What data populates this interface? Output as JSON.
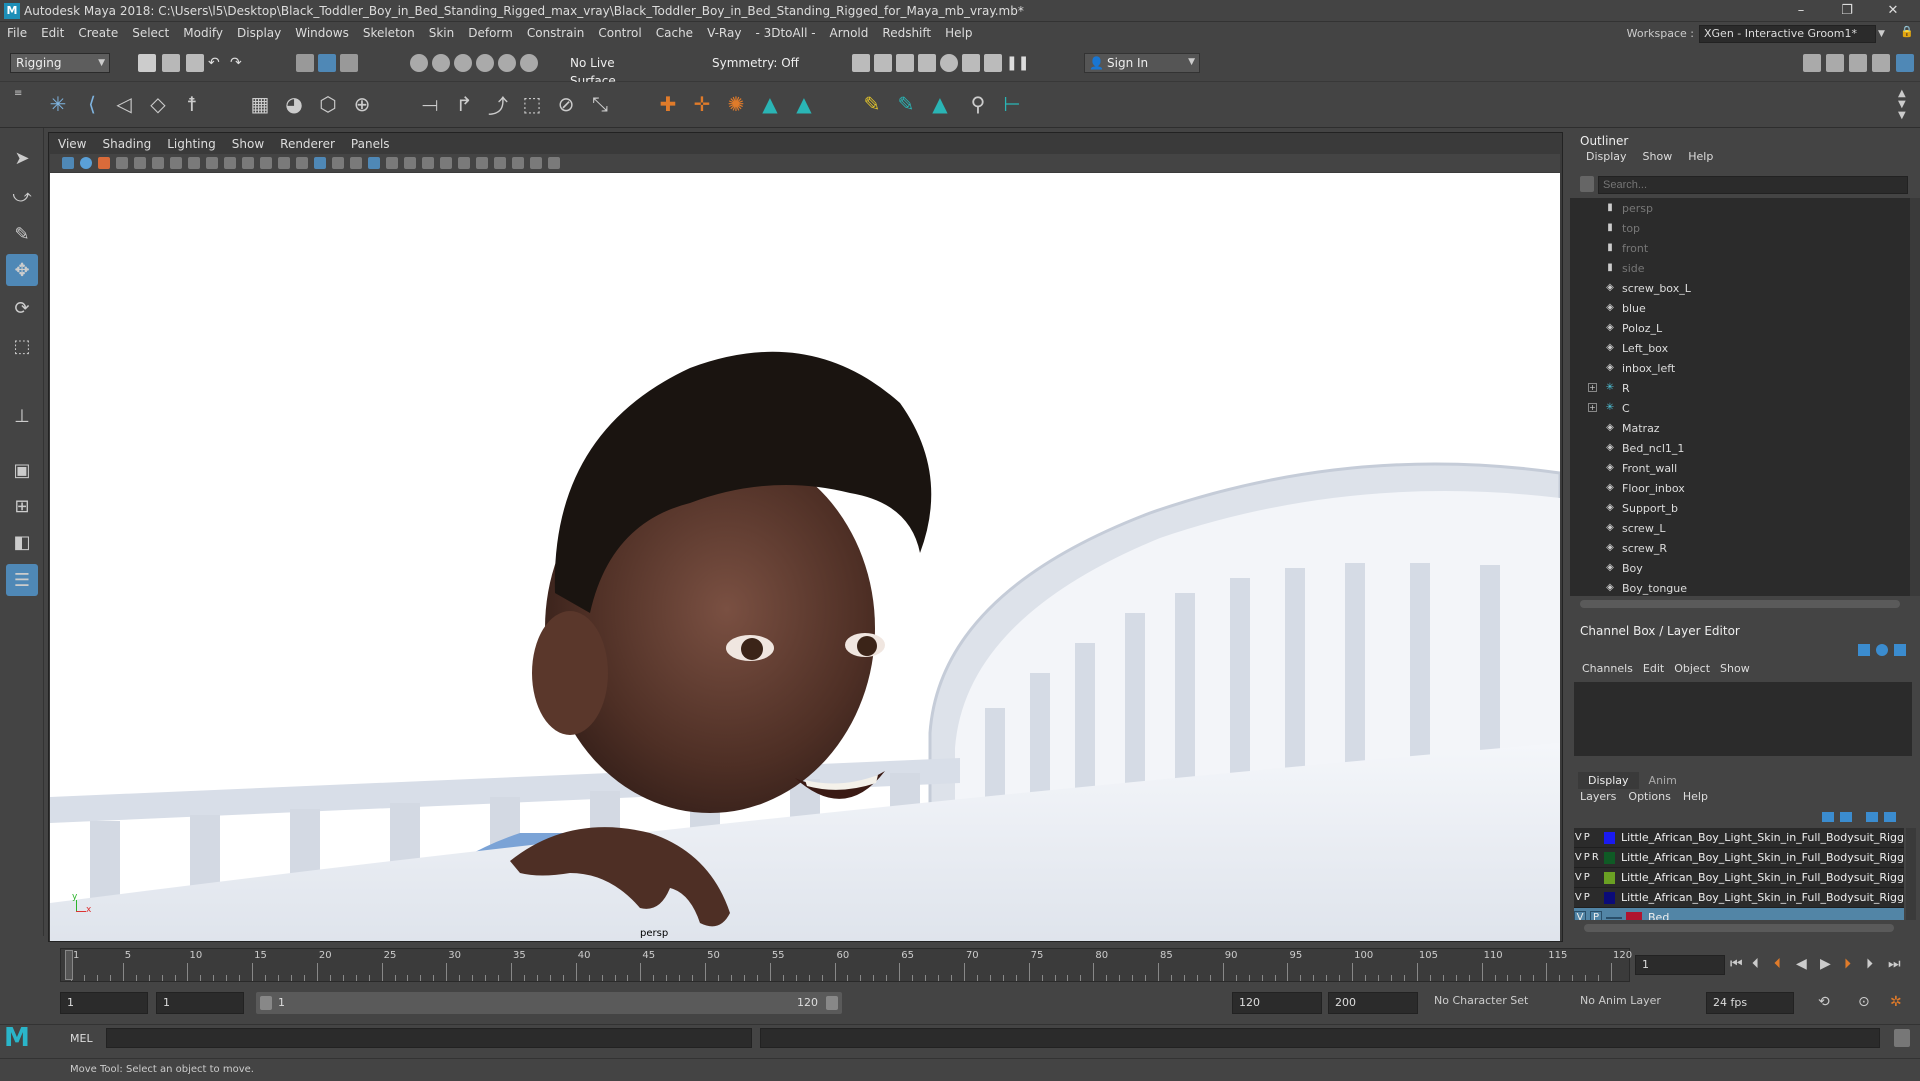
{
  "window": {
    "title": "Autodesk Maya 2018: C:\\Users\\l5\\Desktop\\Black_Toddler_Boy_in_Bed_Standing_Rigged_max_vray\\Black_Toddler_Boy_in_Bed_Standing_Rigged_for_Maya_mb_vray.mb*",
    "minimize": "–",
    "maximize": "❐",
    "close": "✕"
  },
  "menubar": [
    "File",
    "Edit",
    "Create",
    "Select",
    "Modify",
    "Display",
    "Windows",
    "Skeleton",
    "Skin",
    "Deform",
    "Constrain",
    "Control",
    "Cache",
    "V-Ray",
    "- 3DtoAll -",
    "Arnold",
    "Redshift",
    "Help"
  ],
  "workspace": {
    "label": "Workspace :",
    "value": "XGen - Interactive Groom1*"
  },
  "statusline": {
    "menuset": "Rigging",
    "live_surface": "No Live Surface",
    "symmetry": "Symmetry: Off",
    "sign_in": "Sign In"
  },
  "viewport": {
    "menus": [
      "View",
      "Shading",
      "Lighting",
      "Show",
      "Renderer",
      "Panels"
    ],
    "camera_label": "persp",
    "axis_x": "x",
    "axis_y": "y"
  },
  "outliner": {
    "title": "Outliner",
    "menus": [
      "Display",
      "Show",
      "Help"
    ],
    "search_placeholder": "Search...",
    "items": [
      {
        "label": "persp",
        "icon": "camera-icon",
        "dim": true
      },
      {
        "label": "top",
        "icon": "camera-icon",
        "dim": true
      },
      {
        "label": "front",
        "icon": "camera-icon",
        "dim": true
      },
      {
        "label": "side",
        "icon": "camera-icon",
        "dim": true
      },
      {
        "label": "screw_box_L",
        "icon": "mesh-icon"
      },
      {
        "label": "blue",
        "icon": "mesh-icon"
      },
      {
        "label": "Poloz_L",
        "icon": "mesh-icon"
      },
      {
        "label": "Left_box",
        "icon": "mesh-icon"
      },
      {
        "label": "inbox_left",
        "icon": "mesh-icon"
      },
      {
        "label": "R",
        "icon": "joint-icon",
        "expand": true
      },
      {
        "label": "C",
        "icon": "joint-icon",
        "expand": true
      },
      {
        "label": "Matraz",
        "icon": "mesh-icon"
      },
      {
        "label": "Bed_ncl1_1",
        "icon": "mesh-icon"
      },
      {
        "label": "Front_wall",
        "icon": "mesh-icon"
      },
      {
        "label": "Floor_inbox",
        "icon": "mesh-icon"
      },
      {
        "label": "Support_b",
        "icon": "mesh-icon"
      },
      {
        "label": "screw_L",
        "icon": "mesh-icon"
      },
      {
        "label": "screw_R",
        "icon": "mesh-icon"
      },
      {
        "label": "Boy",
        "icon": "mesh-icon"
      },
      {
        "label": "Boy_tongue",
        "icon": "mesh-icon"
      }
    ]
  },
  "channelbox": {
    "title": "Channel Box / Layer Editor",
    "menus": [
      "Channels",
      "Edit",
      "Object",
      "Show"
    ]
  },
  "layers": {
    "tabs": [
      "Display",
      "Anim"
    ],
    "menus": [
      "Layers",
      "Options",
      "Help"
    ],
    "rows": [
      {
        "v": "V",
        "p": "P",
        "r": "",
        "color": "#1a1af0",
        "name": "Little_African_Boy_Light_Skin_in_Full_Bodysuit_Rigg"
      },
      {
        "v": "V",
        "p": "P",
        "r": "R",
        "color": "#0f5a25",
        "name": "Little_African_Boy_Light_Skin_in_Full_Bodysuit_Rigg"
      },
      {
        "v": "V",
        "p": "P",
        "r": "",
        "color": "#6aa023",
        "name": "Little_African_Boy_Light_Skin_in_Full_Bodysuit_Rigg"
      },
      {
        "v": "V",
        "p": "P",
        "r": "",
        "color": "#0b0b78",
        "name": "Little_African_Boy_Light_Skin_in_Full_Bodysuit_Rigg"
      },
      {
        "v": "V",
        "p": "P",
        "r": "",
        "color": "#b0142e",
        "name": "Bed",
        "selected": true
      }
    ]
  },
  "timeline": {
    "ticks": [
      "1",
      "5",
      "10",
      "15",
      "20",
      "25",
      "30",
      "35",
      "40",
      "45",
      "50",
      "55",
      "60",
      "65",
      "70",
      "75",
      "80",
      "85",
      "90",
      "95",
      "100",
      "105",
      "110",
      "115",
      "120"
    ],
    "current_frame": "1"
  },
  "range": {
    "start": "1",
    "playback_start": "1",
    "slider_start": "1",
    "slider_end": "120",
    "playback_end": "120",
    "end": "200",
    "character_set": "No Character Set",
    "anim_layer": "No Anim Layer",
    "fps": "24 fps"
  },
  "commandline": {
    "label": "MEL"
  },
  "helpline": {
    "text": "Move Tool: Select an object to move."
  }
}
